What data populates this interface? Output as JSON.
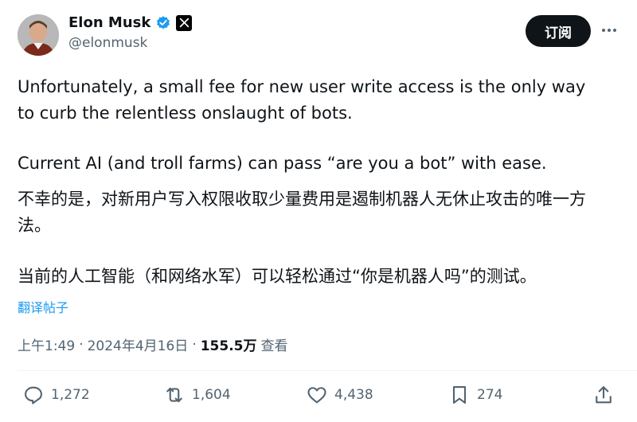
{
  "author": {
    "display_name": "Elon Musk",
    "handle": "@elonmusk",
    "avatar_icon": "profile-photo",
    "verified_color": "#1d9bf0"
  },
  "header": {
    "subscribe_label": "订阅",
    "more_icon": "more-horizontal-icon"
  },
  "tweet": {
    "paragraph_1": "Unfortunately, a small fee for new user write access is the only way to curb the relentless onslaught of bots.",
    "paragraph_2": "Current AI (and troll farms) can pass “are you a bot” with ease.",
    "paragraph_3": "不幸的是，对新用户写入权限收取少量费用是遏制机器人无休止攻击的唯一方法。",
    "paragraph_4": "当前的人工智能（和网络水军）可以轻松通过“你是机器人吗”的测试。"
  },
  "translate_label": "翻译帖子",
  "meta": {
    "time": "上午1:49",
    "date": "2024年4月16日",
    "views_count": "155.5万",
    "views_label": "查看",
    "separator": "·"
  },
  "actions": {
    "replies": "1,272",
    "reposts": "1,604",
    "likes": "4,438",
    "bookmarks": "274"
  },
  "colors": {
    "accent": "#1d9bf0",
    "text": "#0f1419",
    "muted": "#536471"
  }
}
